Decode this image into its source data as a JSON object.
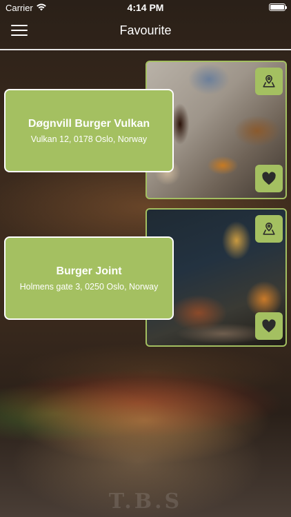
{
  "status_bar": {
    "carrier": "Carrier",
    "time": "4:14 PM"
  },
  "nav": {
    "title": "Favourite",
    "menu_icon": "hamburger-menu-icon"
  },
  "favourites": [
    {
      "name": "Døgnvill Burger Vulkan",
      "address": "Vulkan 12, 0178 Oslo, Norway",
      "map_icon": "map-pin-icon",
      "favourite_icon": "heart-icon"
    },
    {
      "name": "Burger Joint",
      "address": "Holmens gate 3, 0250 Oslo, Norway",
      "map_icon": "map-pin-icon",
      "favourite_icon": "heart-icon"
    }
  ],
  "colors": {
    "accent": "#a4c061",
    "text": "#ffffff",
    "divider": "#e8e8e8"
  }
}
